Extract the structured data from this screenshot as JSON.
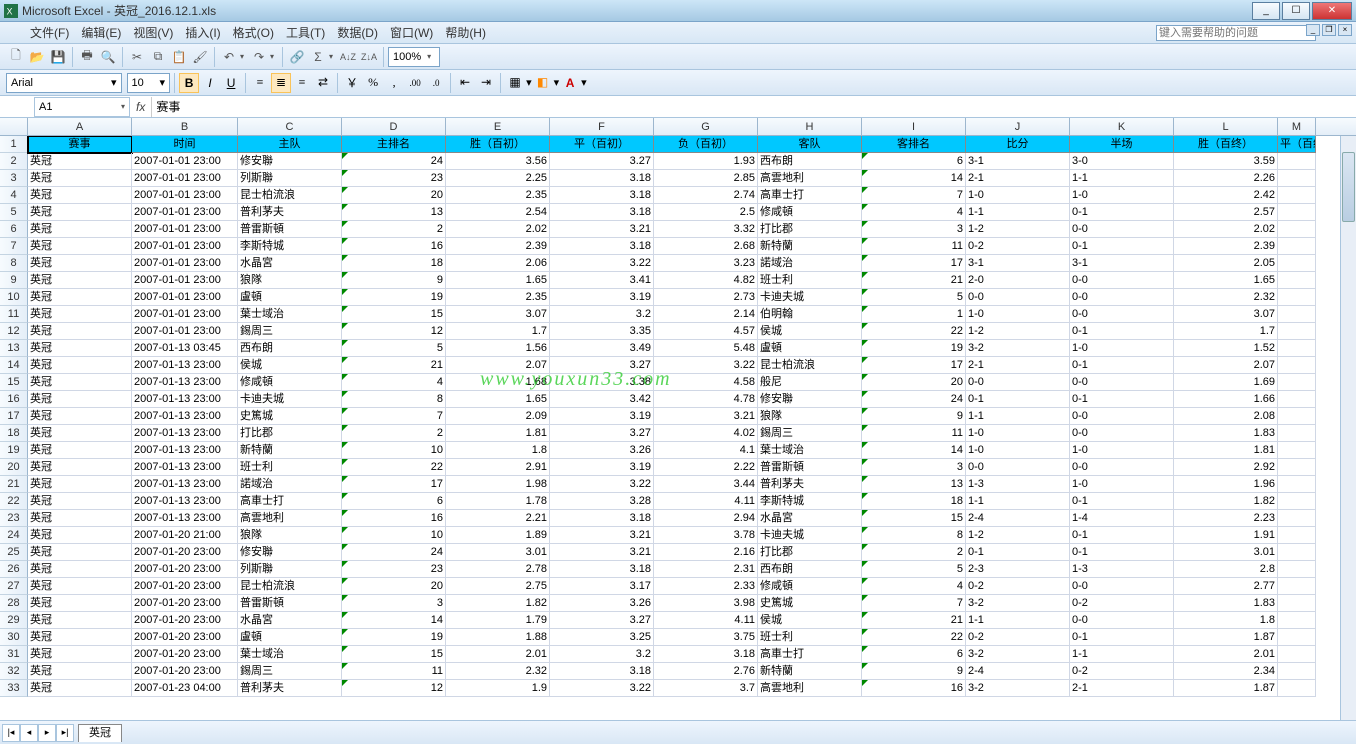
{
  "app_title": "Microsoft Excel - 英冠_2016.12.1.xls",
  "menus": [
    "文件(F)",
    "编辑(E)",
    "视图(V)",
    "插入(I)",
    "格式(O)",
    "工具(T)",
    "数据(D)",
    "窗口(W)",
    "帮助(H)"
  ],
  "help_placeholder": "键入需要帮助的问题",
  "zoom": "100%",
  "font_name": "Arial",
  "font_size": "10",
  "name_box": "A1",
  "formula_bar": "赛事",
  "sheet_tab": "英冠",
  "columns": [
    "A",
    "B",
    "C",
    "D",
    "E",
    "F",
    "G",
    "H",
    "I",
    "J",
    "K",
    "L",
    "M"
  ],
  "headers": [
    "赛事",
    "时间",
    "主队",
    "主排名",
    "胜（百初）",
    "平（百初）",
    "负（百初）",
    "客队",
    "客排名",
    "比分",
    "半场",
    "胜（百终）",
    "平（百终"
  ],
  "rows": [
    [
      "英冠",
      "2007-01-01 23:00",
      "修安聯",
      "24",
      "3.56",
      "3.27",
      "1.93",
      "西布朗",
      "6",
      "3-1",
      "3-0",
      "3.59",
      ""
    ],
    [
      "英冠",
      "2007-01-01 23:00",
      "列斯聯",
      "23",
      "2.25",
      "3.18",
      "2.85",
      "高雲地利",
      "14",
      "2-1",
      "1-1",
      "2.26",
      ""
    ],
    [
      "英冠",
      "2007-01-01 23:00",
      "昆士柏流浪",
      "20",
      "2.35",
      "3.18",
      "2.74",
      "高車士打",
      "7",
      "1-0",
      "1-0",
      "2.42",
      ""
    ],
    [
      "英冠",
      "2007-01-01 23:00",
      "普利茅夫",
      "13",
      "2.54",
      "3.18",
      "2.5",
      "修咸頓",
      "4",
      "1-1",
      "0-1",
      "2.57",
      ""
    ],
    [
      "英冠",
      "2007-01-01 23:00",
      "普雷斯頓",
      "2",
      "2.02",
      "3.21",
      "3.32",
      "打比郡",
      "3",
      "1-2",
      "0-0",
      "2.02",
      ""
    ],
    [
      "英冠",
      "2007-01-01 23:00",
      "李斯特城",
      "16",
      "2.39",
      "3.18",
      "2.68",
      "新特蘭",
      "11",
      "0-2",
      "0-1",
      "2.39",
      ""
    ],
    [
      "英冠",
      "2007-01-01 23:00",
      "水晶宮",
      "18",
      "2.06",
      "3.22",
      "3.23",
      "諾域治",
      "17",
      "3-1",
      "3-1",
      "2.05",
      ""
    ],
    [
      "英冠",
      "2007-01-01 23:00",
      "狼隊",
      "9",
      "1.65",
      "3.41",
      "4.82",
      "班士利",
      "21",
      "2-0",
      "0-0",
      "1.65",
      ""
    ],
    [
      "英冠",
      "2007-01-01 23:00",
      "盧頓",
      "19",
      "2.35",
      "3.19",
      "2.73",
      "卡迪夫城",
      "5",
      "0-0",
      "0-0",
      "2.32",
      ""
    ],
    [
      "英冠",
      "2007-01-01 23:00",
      "葉士域治",
      "15",
      "3.07",
      "3.2",
      "2.14",
      "伯明翰",
      "1",
      "1-0",
      "0-0",
      "3.07",
      ""
    ],
    [
      "英冠",
      "2007-01-01 23:00",
      "錫周三",
      "12",
      "1.7",
      "3.35",
      "4.57",
      "侯城",
      "22",
      "1-2",
      "0-1",
      "1.7",
      ""
    ],
    [
      "英冠",
      "2007-01-13 03:45",
      "西布朗",
      "5",
      "1.56",
      "3.49",
      "5.48",
      "盧頓",
      "19",
      "3-2",
      "1-0",
      "1.52",
      ""
    ],
    [
      "英冠",
      "2007-01-13 23:00",
      "侯城",
      "21",
      "2.07",
      "3.27",
      "3.22",
      "昆士柏流浪",
      "17",
      "2-1",
      "0-1",
      "2.07",
      ""
    ],
    [
      "英冠",
      "2007-01-13 23:00",
      "修咸頓",
      "4",
      "1.68",
      "3.38",
      "4.58",
      "般尼",
      "20",
      "0-0",
      "0-0",
      "1.69",
      ""
    ],
    [
      "英冠",
      "2007-01-13 23:00",
      "卡迪夫城",
      "8",
      "1.65",
      "3.42",
      "4.78",
      "修安聯",
      "24",
      "0-1",
      "0-1",
      "1.66",
      ""
    ],
    [
      "英冠",
      "2007-01-13 23:00",
      "史篤城",
      "7",
      "2.09",
      "3.19",
      "3.21",
      "狼隊",
      "9",
      "1-1",
      "0-0",
      "2.08",
      ""
    ],
    [
      "英冠",
      "2007-01-13 23:00",
      "打比郡",
      "2",
      "1.81",
      "3.27",
      "4.02",
      "錫周三",
      "11",
      "1-0",
      "0-0",
      "1.83",
      ""
    ],
    [
      "英冠",
      "2007-01-13 23:00",
      "新特蘭",
      "10",
      "1.8",
      "3.26",
      "4.1",
      "葉士域治",
      "14",
      "1-0",
      "1-0",
      "1.81",
      ""
    ],
    [
      "英冠",
      "2007-01-13 23:00",
      "班士利",
      "22",
      "2.91",
      "3.19",
      "2.22",
      "普雷斯頓",
      "3",
      "0-0",
      "0-0",
      "2.92",
      ""
    ],
    [
      "英冠",
      "2007-01-13 23:00",
      "諾域治",
      "17",
      "1.98",
      "3.22",
      "3.44",
      "普利茅夫",
      "13",
      "1-3",
      "1-0",
      "1.96",
      ""
    ],
    [
      "英冠",
      "2007-01-13 23:00",
      "高車士打",
      "6",
      "1.78",
      "3.28",
      "4.11",
      "李斯特城",
      "18",
      "1-1",
      "0-1",
      "1.82",
      ""
    ],
    [
      "英冠",
      "2007-01-13 23:00",
      "高雲地利",
      "16",
      "2.21",
      "3.18",
      "2.94",
      "水晶宮",
      "15",
      "2-4",
      "1-4",
      "2.23",
      ""
    ],
    [
      "英冠",
      "2007-01-20 21:00",
      "狼隊",
      "10",
      "1.89",
      "3.21",
      "3.78",
      "卡迪夫城",
      "8",
      "1-2",
      "0-1",
      "1.91",
      ""
    ],
    [
      "英冠",
      "2007-01-20 23:00",
      "修安聯",
      "24",
      "3.01",
      "3.21",
      "2.16",
      "打比郡",
      "2",
      "0-1",
      "0-1",
      "3.01",
      ""
    ],
    [
      "英冠",
      "2007-01-20 23:00",
      "列斯聯",
      "23",
      "2.78",
      "3.18",
      "2.31",
      "西布朗",
      "5",
      "2-3",
      "1-3",
      "2.8",
      ""
    ],
    [
      "英冠",
      "2007-01-20 23:00",
      "昆士柏流浪",
      "20",
      "2.75",
      "3.17",
      "2.33",
      "修咸頓",
      "4",
      "0-2",
      "0-0",
      "2.77",
      ""
    ],
    [
      "英冠",
      "2007-01-20 23:00",
      "普雷斯頓",
      "3",
      "1.82",
      "3.26",
      "3.98",
      "史篤城",
      "7",
      "3-2",
      "0-2",
      "1.83",
      ""
    ],
    [
      "英冠",
      "2007-01-20 23:00",
      "水晶宮",
      "14",
      "1.79",
      "3.27",
      "4.11",
      "侯城",
      "21",
      "1-1",
      "0-0",
      "1.8",
      ""
    ],
    [
      "英冠",
      "2007-01-20 23:00",
      "盧頓",
      "19",
      "1.88",
      "3.25",
      "3.75",
      "班士利",
      "22",
      "0-2",
      "0-1",
      "1.87",
      ""
    ],
    [
      "英冠",
      "2007-01-20 23:00",
      "葉士域治",
      "15",
      "2.01",
      "3.2",
      "3.18",
      "高車士打",
      "6",
      "3-2",
      "1-1",
      "2.01",
      ""
    ],
    [
      "英冠",
      "2007-01-20 23:00",
      "錫周三",
      "11",
      "2.32",
      "3.18",
      "2.76",
      "新特蘭",
      "9",
      "2-4",
      "0-2",
      "2.34",
      ""
    ],
    [
      "英冠",
      "2007-01-23 04:00",
      "普利茅夫",
      "12",
      "1.9",
      "3.22",
      "3.7",
      "高雲地利",
      "16",
      "3-2",
      "2-1",
      "1.87",
      ""
    ]
  ],
  "watermark": "www.youxun33.com"
}
